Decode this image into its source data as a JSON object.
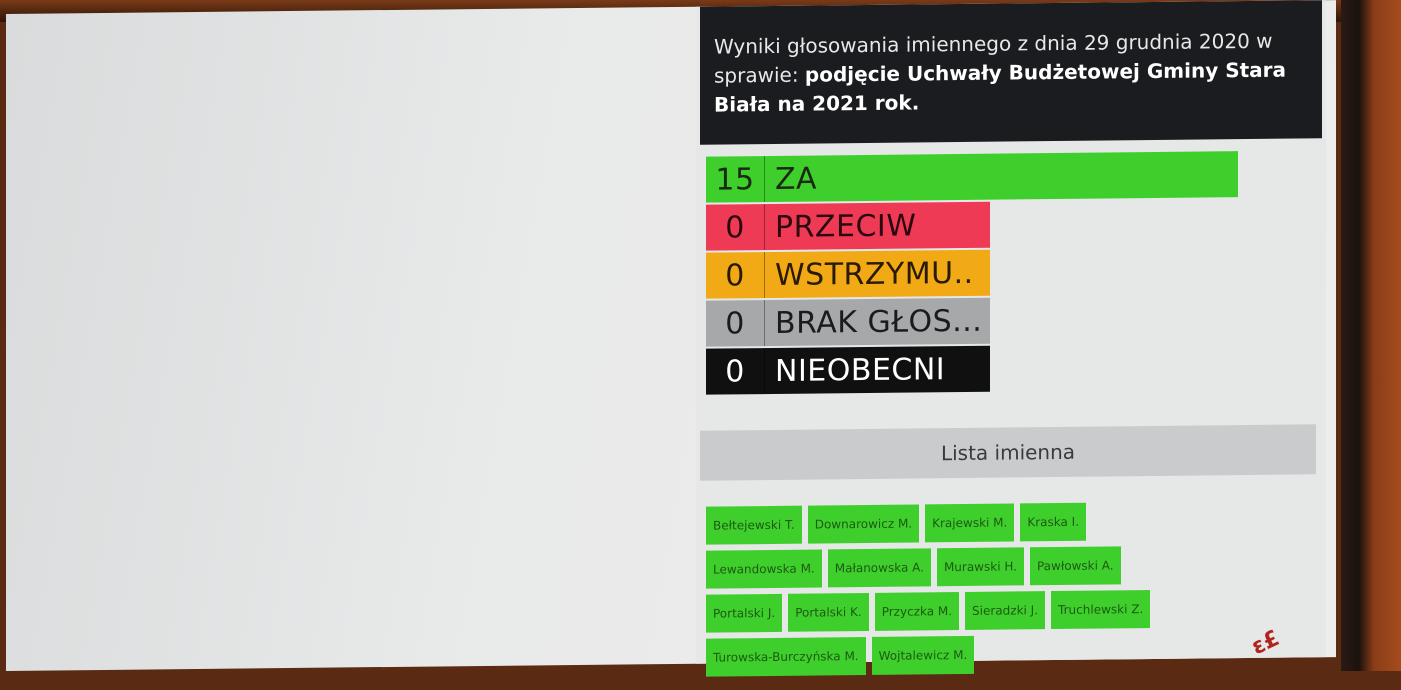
{
  "title": {
    "prefix": "Wyniki głosowania imiennego z dnia 29 grudnia 2020 w sprawie: ",
    "subject": "podjęcie Uchwały Budżetowej Gminy Stara Biała na 2021 rok."
  },
  "votes": [
    {
      "count": "15",
      "label": "ZA",
      "color": "#3fcf2d",
      "text_color": "#1a2a12"
    },
    {
      "count": "0",
      "label": "PRZECIW",
      "color": "#ef3a56",
      "text_color": "#2a0a10"
    },
    {
      "count": "0",
      "label": "WSTRZYMU..",
      "color": "#f1aa16",
      "text_color": "#2a1a05"
    },
    {
      "count": "0",
      "label": "BRAK GŁOS...",
      "color": "#a7a8aa",
      "text_color": "#1b1b1b"
    },
    {
      "count": "0",
      "label": "NIEOBECNI",
      "color": "#101010",
      "text_color": "#ffffff"
    }
  ],
  "list_header": "Lista imienna",
  "names": [
    [
      "Bełtejewski T.",
      "Downarowicz M.",
      "Krajewski M.",
      "Kraska I."
    ],
    [
      "Lewandowska M.",
      "Małanowska A.",
      "Murawski H.",
      "Pawłowski A."
    ],
    [
      "Portalski J.",
      "Portalski K.",
      "Przyczka M.",
      "Sieradzki J.",
      "Truchlewski Z."
    ],
    [
      "Turowska-Burczyńska M.",
      "Wojtalewicz M."
    ]
  ],
  "logo": "ε£"
}
